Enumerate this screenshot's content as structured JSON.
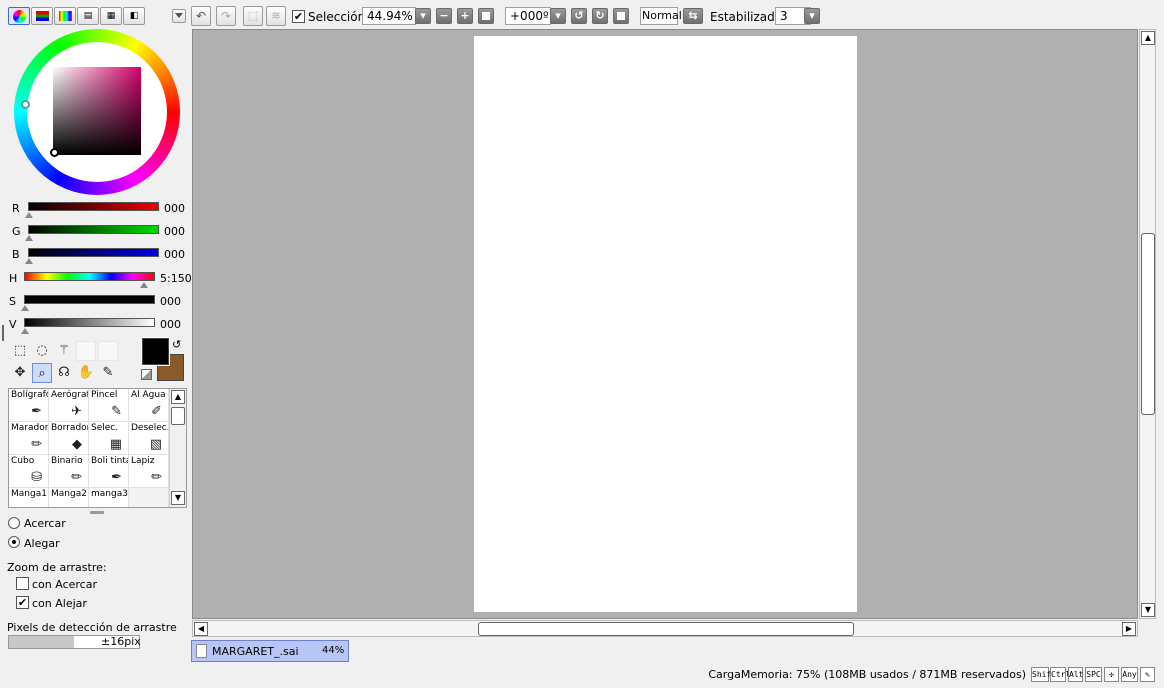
{
  "toolbar": {
    "selection_label": "Selección",
    "zoom_value": "44.94%",
    "rotation_value": "+000º",
    "blend_mode": "Normal",
    "stabilizer_label": "Estabilizador",
    "stabilizer_value": "3"
  },
  "color": {
    "r_label": "R",
    "r_value": "000",
    "g_label": "G",
    "g_value": "000",
    "b_label": "B",
    "b_value": "000",
    "h_label": "H",
    "h_value": "5:150",
    "s_label": "S",
    "s_value": "000",
    "v_label": "V",
    "v_value": "000",
    "primary": "#000000",
    "secondary": "#8a5a2b"
  },
  "brushes": [
    {
      "name": "Bolígrafo",
      "icon": "pen-icon"
    },
    {
      "name": "Aerógrafo",
      "icon": "airbrush-icon"
    },
    {
      "name": "Pincel",
      "icon": "brush-icon"
    },
    {
      "name": "Al Agua",
      "icon": "watercolor-icon"
    },
    {
      "name": "Marador",
      "icon": "marker-icon"
    },
    {
      "name": "Borrador",
      "icon": "eraser-icon"
    },
    {
      "name": "Selec.",
      "icon": "select-brush-icon"
    },
    {
      "name": "Deselec.",
      "icon": "deselect-brush-icon"
    },
    {
      "name": "Cubo",
      "icon": "bucket-icon"
    },
    {
      "name": "Binario",
      "icon": "binary-pen-icon"
    },
    {
      "name": "Boli tinta",
      "icon": "ink-pen-icon"
    },
    {
      "name": "Lapiz",
      "icon": "pencil-icon"
    },
    {
      "name": "Manga1",
      "icon": "pen-icon"
    },
    {
      "name": "Manga2",
      "icon": "pen-icon"
    },
    {
      "name": "manga3",
      "icon": "pen-icon"
    }
  ],
  "zoom_options": {
    "acercar": "Acercar",
    "alejar": "Alegar",
    "drag_zoom_label": "Zoom de arrastre:",
    "con_acercar": "con Acercar",
    "con_alejar": "con Alejar",
    "pixels_label": "Pixels de detección de arrastre",
    "pixels_value": "±16pix"
  },
  "document_tab": {
    "name": "MARGARET_.sai",
    "zoom": "44%"
  },
  "status": {
    "memory": "CargaMemoria: 75% (108MB usados / 871MB reservados)",
    "keys": [
      "Shift",
      "Ctrl",
      "Alt",
      "SPC"
    ],
    "any_label": "Any"
  }
}
